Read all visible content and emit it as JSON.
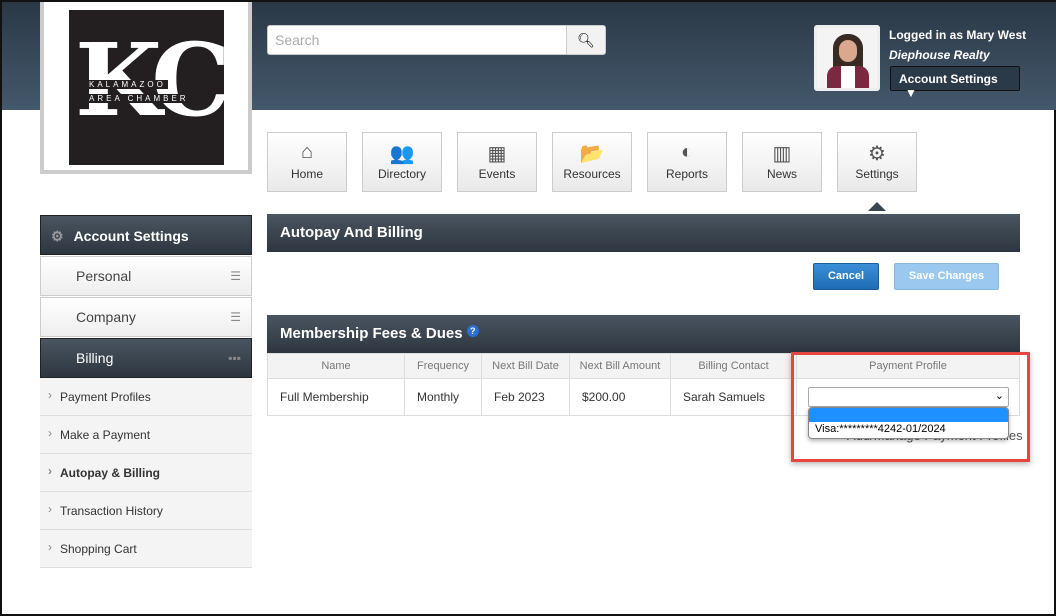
{
  "logo": {
    "letters": "KC",
    "line1": "KALAMAZOO",
    "line2": "AREA CHAMBER"
  },
  "search": {
    "placeholder": "Search"
  },
  "user": {
    "login": "Logged in as Mary West",
    "company": "Diephouse Realty",
    "account_button": "Account Settings"
  },
  "nav": [
    {
      "label": "Home",
      "icon": "⌂"
    },
    {
      "label": "Directory",
      "icon": "👥"
    },
    {
      "label": "Events",
      "icon": "▦"
    },
    {
      "label": "Resources",
      "icon": "📂"
    },
    {
      "label": "Reports",
      "icon": "◐"
    },
    {
      "label": "News",
      "icon": "▥"
    },
    {
      "label": "Settings",
      "icon": "⚙"
    }
  ],
  "sidebar": {
    "header": "Account Settings",
    "items": [
      "Personal",
      "Company",
      "Billing"
    ],
    "sub": [
      "Payment Profiles",
      "Make a Payment",
      "Autopay & Billing",
      "Transaction History",
      "Shopping Cart"
    ]
  },
  "main": {
    "title": "Autopay And Billing",
    "cancel": "Cancel",
    "save": "Save Changes",
    "section": "Membership Fees & Dues",
    "columns": [
      "Name",
      "Frequency",
      "Next Bill Date",
      "Next Bill Amount",
      "Billing Contact",
      "Payment Profile"
    ],
    "row": [
      "Full Membership",
      "Monthly",
      "Feb 2023",
      "$200.00",
      "Sarah Samuels"
    ],
    "dropdown_option": "Visa:*********4242-01/2024",
    "add_link": "Add/Manage Payment Profiles"
  }
}
